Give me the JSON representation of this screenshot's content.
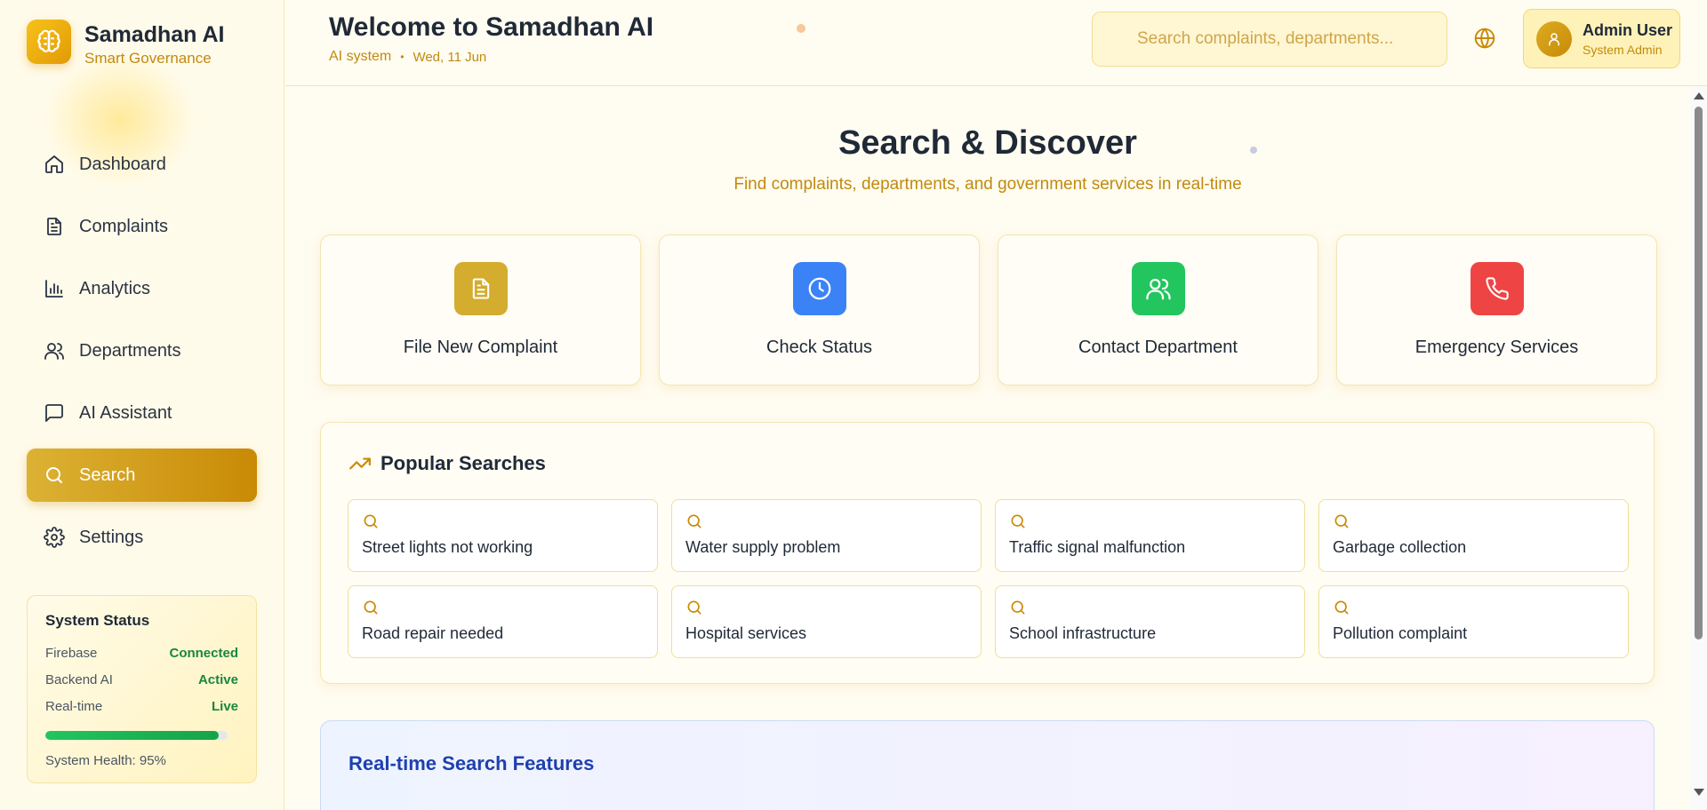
{
  "brand": {
    "title": "Samadhan AI",
    "subtitle": "Smart Governance"
  },
  "nav": {
    "items": [
      {
        "label": "Dashboard",
        "icon": "home-icon"
      },
      {
        "label": "Complaints",
        "icon": "document-icon"
      },
      {
        "label": "Analytics",
        "icon": "bar-chart-icon"
      },
      {
        "label": "Departments",
        "icon": "users-icon"
      },
      {
        "label": "AI Assistant",
        "icon": "chat-icon"
      },
      {
        "label": "Search",
        "icon": "search-icon",
        "active": true
      },
      {
        "label": "Settings",
        "icon": "gear-icon"
      }
    ]
  },
  "system_status": {
    "title": "System Status",
    "rows": [
      {
        "label": "Firebase",
        "value": "Connected"
      },
      {
        "label": "Backend AI",
        "value": "Active"
      },
      {
        "label": "Real-time",
        "value": "Live"
      }
    ],
    "health_fraction": 0.95,
    "health_text": "System Health: 95%"
  },
  "header": {
    "title": "Welcome to Samadhan AI",
    "system_label": "AI system",
    "separator": "•",
    "date": "Wed, 11 Jun",
    "search_placeholder": "Search complaints, departments...",
    "language_icon": "globe-icon",
    "user": {
      "name": "Admin User",
      "role": "System Admin",
      "icon": "user-icon"
    }
  },
  "main": {
    "title": "Search & Discover",
    "subtitle": "Find complaints, departments, and government services in real-time",
    "actions": [
      {
        "label": "File New Complaint",
        "icon": "document-icon",
        "color": "#d4ac2e"
      },
      {
        "label": "Check Status",
        "icon": "clock-icon",
        "color": "#3b82f6"
      },
      {
        "label": "Contact Department",
        "icon": "users-icon",
        "color": "#22c55e"
      },
      {
        "label": "Emergency Services",
        "icon": "phone-icon",
        "color": "#ef4444"
      }
    ],
    "popular": {
      "title": "Popular Searches",
      "items": [
        "Street lights not working",
        "Water supply problem",
        "Traffic signal malfunction",
        "Garbage collection",
        "Road repair needed",
        "Hospital services",
        "School infrastructure",
        "Pollution complaint"
      ]
    },
    "features": {
      "title": "Real-time Search Features"
    }
  },
  "colors": {
    "accent": "#c98a05",
    "accent_light": "#dcb234",
    "text_gold": "#c18a0e",
    "success": "#17883d",
    "features_title": "#1e40af"
  }
}
